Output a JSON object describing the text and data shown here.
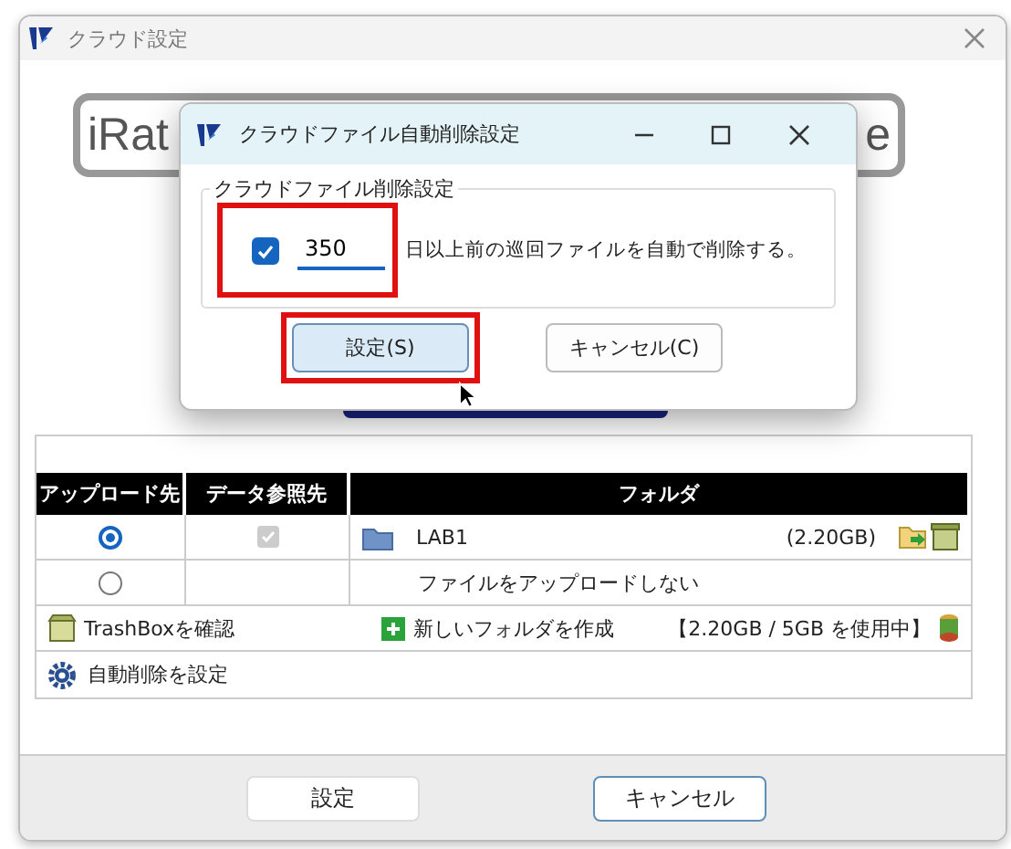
{
  "window": {
    "title": "クラウド設定"
  },
  "banner": {
    "text_left": "iRat",
    "text_right": "e"
  },
  "table": {
    "columns": [
      "アップロード先",
      "データ参照先",
      "フォルダ"
    ],
    "rows": [
      {
        "selected": true,
        "kind": "folder",
        "reference": {
          "checked": true,
          "disabled": true
        },
        "folder": "LAB1",
        "size": "(2.20GB)"
      },
      {
        "selected": false,
        "kind": "none",
        "folder": "ファイルをアップロードしない"
      }
    ]
  },
  "actions": {
    "trash": "TrashBoxを確認",
    "new_folder": "新しいフォルダを作成",
    "usage": "【2.20GB / 5GB を使用中】",
    "auto_delete": "自動削除を設定"
  },
  "buttons": [
    {
      "label": "設定",
      "focused": false
    },
    {
      "label": "キャンセル",
      "focused": true
    }
  ],
  "dialog": {
    "title": "クラウドファイル自動削除設定",
    "group_label": "クラウドファイル削除設定",
    "checked": true,
    "days": "350",
    "suffix": "日以上前の巡回ファイルを自動で削除する。",
    "highlighted": true,
    "buttons": [
      {
        "label": "設定(S)",
        "focused": true,
        "highlighted": true
      },
      {
        "label": "キャンセル(C)",
        "focused": false,
        "highlighted": false
      }
    ]
  }
}
